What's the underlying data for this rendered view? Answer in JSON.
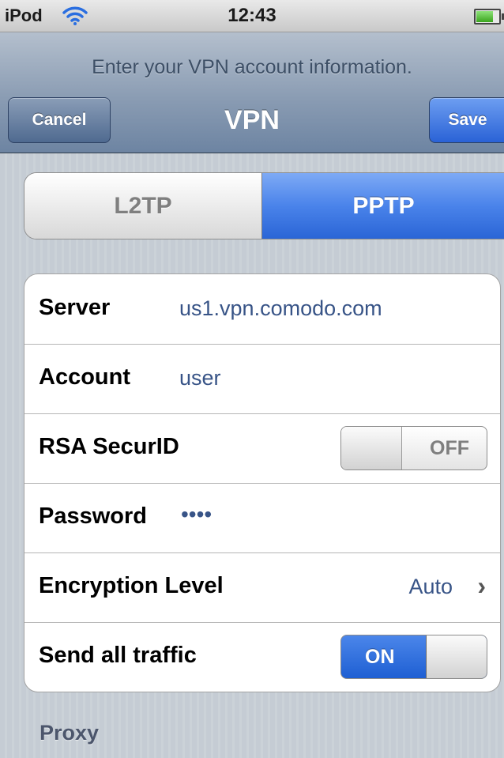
{
  "status_bar": {
    "device": "iPod",
    "time": "12:43",
    "wifi_icon": "wifi-icon",
    "battery_icon": "battery-icon"
  },
  "nav": {
    "prompt": "Enter your VPN account information.",
    "title": "VPN",
    "cancel_label": "Cancel",
    "save_label": "Save"
  },
  "protocol_tabs": {
    "options": [
      "L2TP",
      "PPTP"
    ],
    "selected": "PPTP"
  },
  "settings": {
    "server": {
      "label": "Server",
      "value": "us1.vpn.comodo.com"
    },
    "account": {
      "label": "Account",
      "value": "user"
    },
    "rsa_securid": {
      "label": "RSA SecurID",
      "state": "OFF"
    },
    "password": {
      "label": "Password",
      "value": "••••"
    },
    "encryption_level": {
      "label": "Encryption Level",
      "value": "Auto",
      "icon": "chevron-right-icon"
    },
    "send_all_traffic": {
      "label": "Send all traffic",
      "state": "ON"
    }
  },
  "proxy_section": {
    "title": "Proxy"
  },
  "colors": {
    "accent_blue": "#2a65d6",
    "value_text": "#385487",
    "background": "#c5ccd4"
  }
}
